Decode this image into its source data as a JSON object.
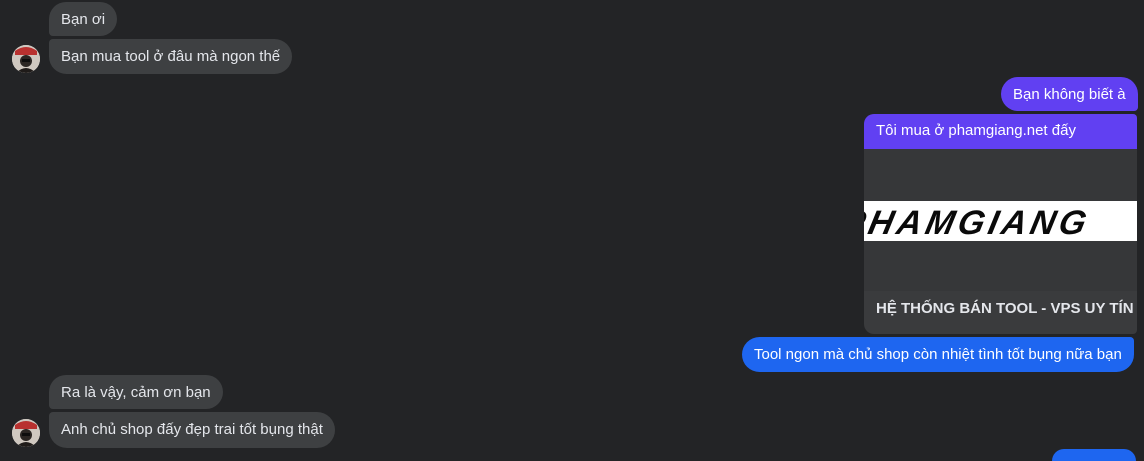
{
  "conversation": {
    "messages": [
      {
        "sender": "them",
        "text": "Bạn ơi"
      },
      {
        "sender": "them",
        "text": "Bạn mua tool ở đâu mà ngon thế"
      },
      {
        "sender": "me",
        "text": "Bạn không biết à"
      },
      {
        "sender": "me",
        "text": "Tôi mua ở phamgiang.net đấy"
      },
      {
        "sender": "me",
        "text": "Tool ngon mà chủ shop còn nhiệt tình tốt bụng nữa bạn"
      },
      {
        "sender": "them",
        "text": "Ra là vậy, cảm ơn bạn"
      },
      {
        "sender": "them",
        "text": "Anh chủ shop đấy đẹp trai tốt bụng thật"
      }
    ],
    "link_preview": {
      "logo_text": "PHAMGIANG",
      "title": "HỆ THỐNG BÁN TOOL - VPS UY TÍN"
    }
  },
  "colors": {
    "background": "#232426",
    "incoming_bubble": "#3e4042",
    "outgoing_purple": "#6140f2",
    "outgoing_blue": "#1e66f0",
    "text": "#e4e6eb"
  }
}
